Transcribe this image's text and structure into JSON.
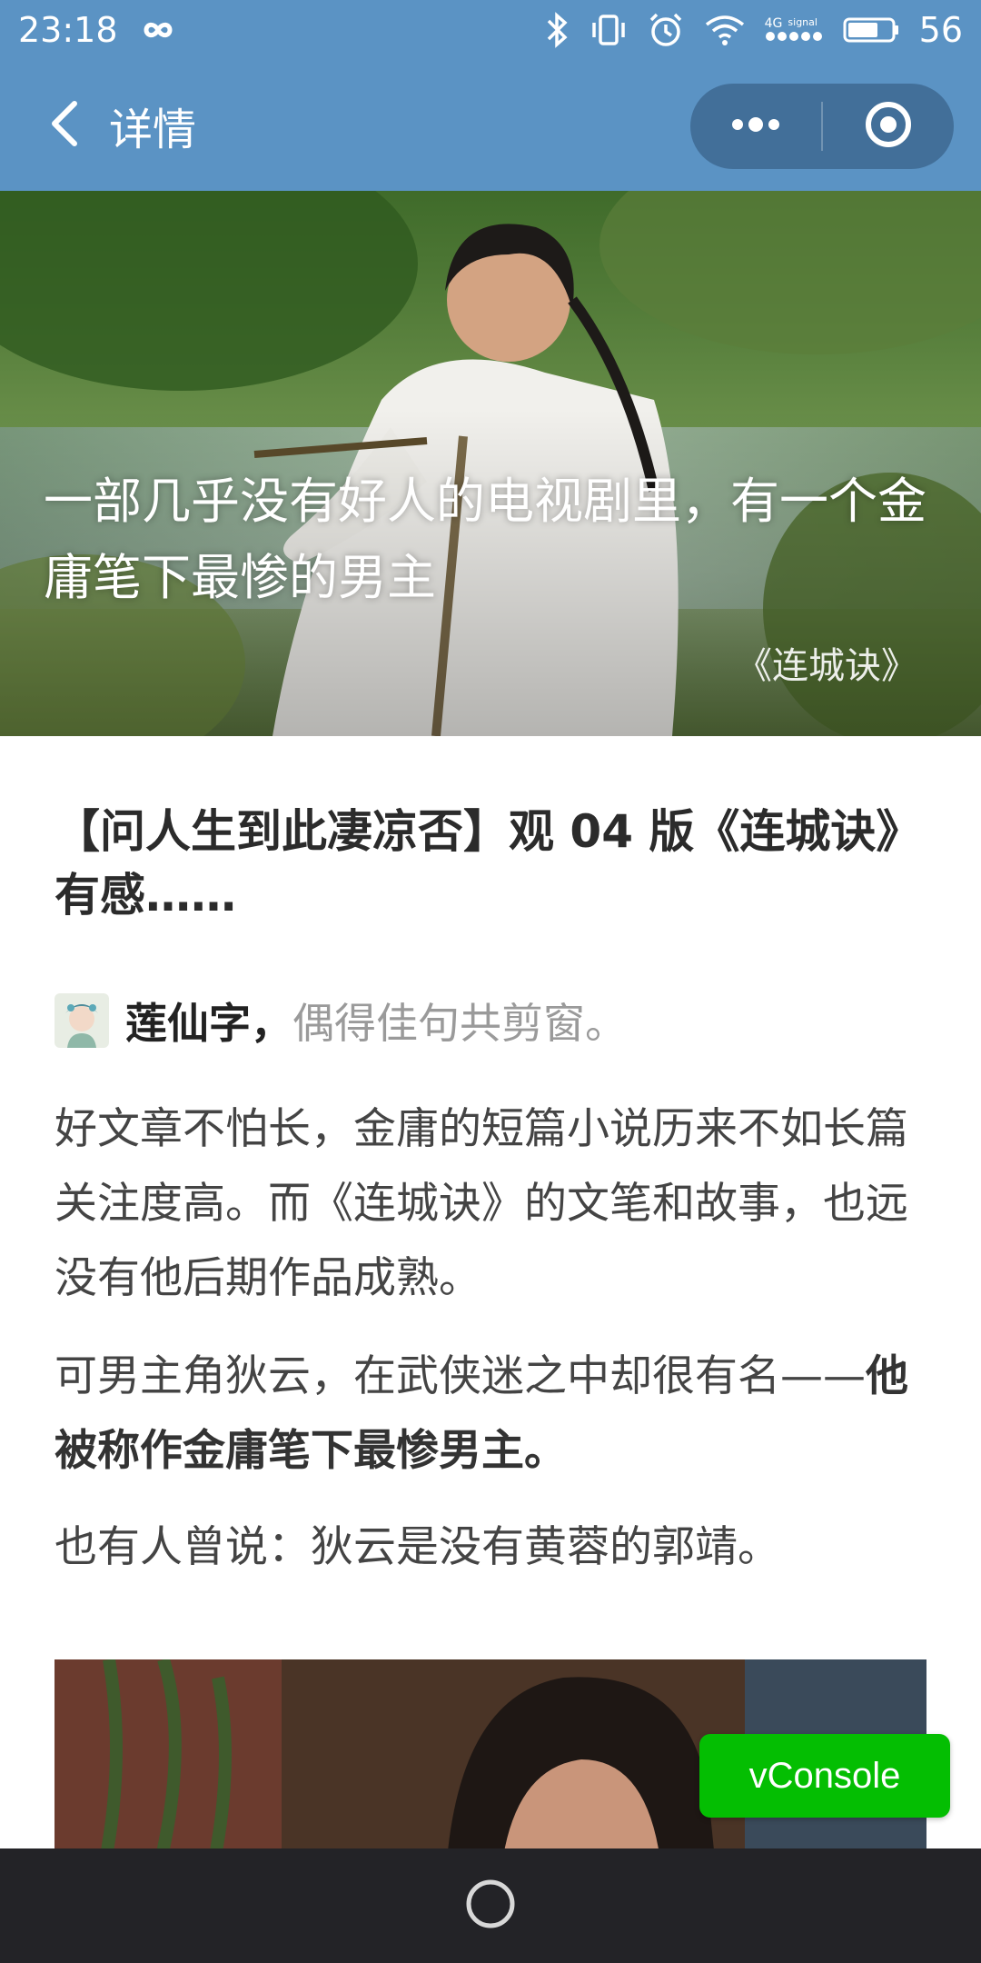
{
  "status_bar": {
    "time": "23:18",
    "infinity_icon": "infinity-icon",
    "network_label": "4G",
    "signal_label": "signal",
    "battery_level": "56"
  },
  "nav": {
    "title": "详情",
    "back_icon": "chevron-left-icon",
    "more_icon": "more-dots-icon",
    "close_icon": "target-icon"
  },
  "hero": {
    "caption": "一部几乎没有好人的电视剧里，有一个金庸笔下最惨的男主",
    "source": "《连城诀》"
  },
  "article": {
    "title": "【问人生到此凄凉否】观 04 版《连城诀》有感……",
    "author_name": "莲仙字，",
    "author_tagline": "偶得佳句共剪窗。",
    "paragraphs": [
      "好文章不怕长，金庸的短篇小说历来不如长篇关注度高。而《连城诀》的文笔和故事，也远没有他后期作品成熟。",
      "可男主角狄云，在武侠迷之中却很有名——",
      "他被称作金庸笔下最惨男主。",
      "也有人曾说：狄云是没有黄蓉的郭靖。"
    ]
  },
  "vconsole": {
    "label": "vConsole",
    "color": "#04be02"
  },
  "colors": {
    "header_bg": "#5b93c4",
    "capsule_bg": "#426f99",
    "system_nav_bg": "#232327"
  }
}
